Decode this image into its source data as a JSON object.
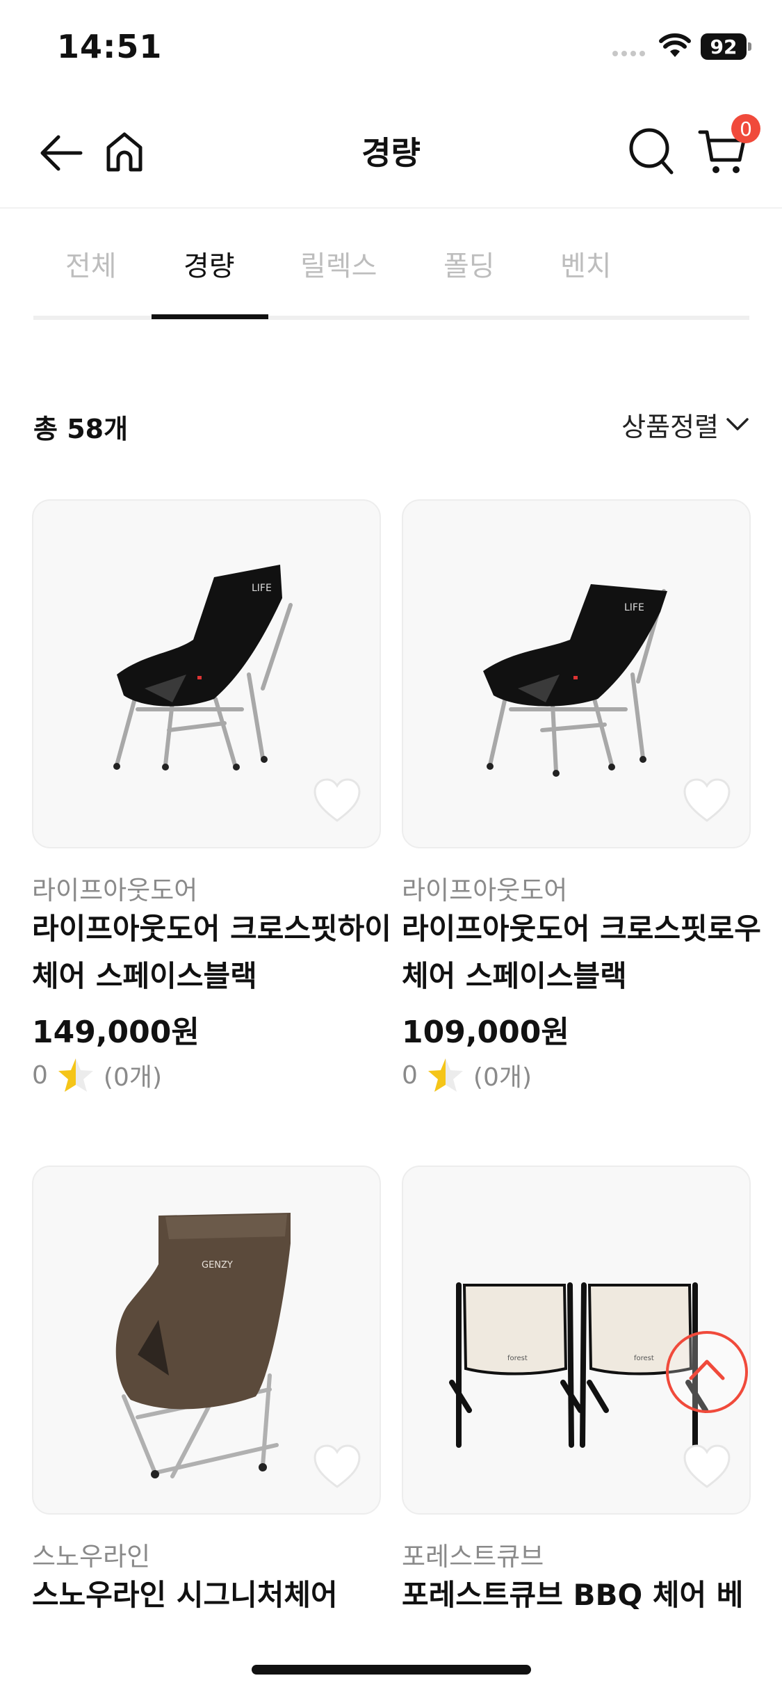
{
  "status_bar": {
    "time": "14:51",
    "battery": "92"
  },
  "header": {
    "title": "경량",
    "cart_count": "0"
  },
  "tabs": [
    {
      "label": "전체"
    },
    {
      "label": "경량"
    },
    {
      "label": "릴렉스"
    },
    {
      "label": "폴딩"
    },
    {
      "label": "벤치"
    }
  ],
  "active_tab": "경량",
  "summary": {
    "total": "총 58개",
    "sort_label": "상품정렬"
  },
  "products": [
    {
      "brand": "라이프아웃도어",
      "name": "라이프아웃도어 크로스핏하이체어 스페이스블랙",
      "price": "149,000원",
      "rating": "0",
      "reviews": "(0개)",
      "image": "black-high-camping-chair"
    },
    {
      "brand": "라이프아웃도어",
      "name": "라이프아웃도어 크로스핏로우체어 스페이스블랙",
      "price": "109,000원",
      "rating": "0",
      "reviews": "(0개)",
      "image": "black-low-camping-chair"
    },
    {
      "brand": "스노우라인",
      "name": "스노우라인 시그니처체어",
      "image": "brown-high-back-chair"
    },
    {
      "brand": "포레스트큐브",
      "name": "포레스트큐브 BBQ 체어 베",
      "image": "ivory-bbq-stool-pair"
    }
  ],
  "colors": {
    "accent": "#f04a3b",
    "star": "#f5c518",
    "muted": "#8a8a8a"
  }
}
